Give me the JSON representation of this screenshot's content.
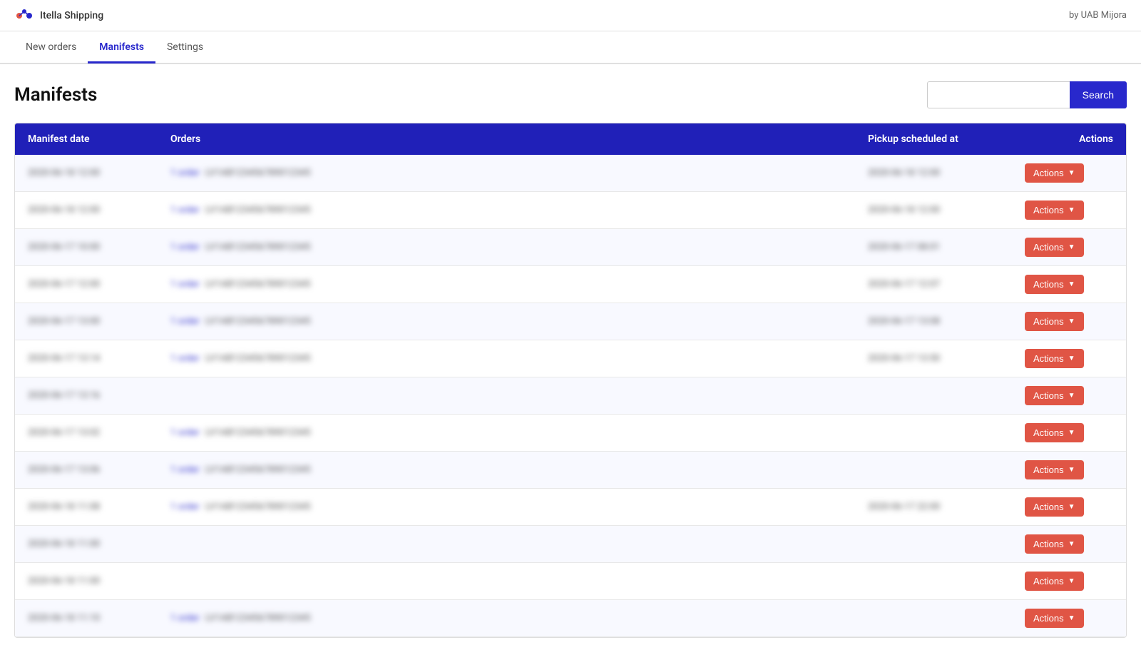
{
  "app": {
    "title": "Itella Shipping",
    "by_label": "by UAB Mijora"
  },
  "nav": {
    "items": [
      {
        "label": "New orders",
        "active": false
      },
      {
        "label": "Manifests",
        "active": true
      },
      {
        "label": "Settings",
        "active": false
      }
    ]
  },
  "page": {
    "title": "Manifests",
    "search_placeholder": "",
    "search_button": "Search"
  },
  "table": {
    "columns": [
      {
        "label": "Manifest date"
      },
      {
        "label": "Orders"
      },
      {
        "label": "Pickup scheduled at"
      },
      {
        "label": "Actions"
      }
    ],
    "rows": [
      {
        "date": "2020-06-18 12:00",
        "order_count": "1 order",
        "order_id": "LV1AB123456789012345",
        "pickup": "2020-06-18 12:00",
        "has_pickup": true
      },
      {
        "date": "2020-06-18 12:00",
        "order_count": "1 order",
        "order_id": "LV1AB123456789012345",
        "pickup": "2020-06-18 12:00",
        "has_pickup": true
      },
      {
        "date": "2020-06-17 10:00",
        "order_count": "1 order",
        "order_id": "LV1AB123456789012345",
        "pickup": "2020-06-17 08:01",
        "has_pickup": true
      },
      {
        "date": "2020-06-17 12:00",
        "order_count": "1 order",
        "order_id": "LV1AB123456789012345",
        "pickup": "2020-06-17 12:07",
        "has_pickup": true
      },
      {
        "date": "2020-06-17 13:00",
        "order_count": "1 order",
        "order_id": "LV1AB123456789012345",
        "pickup": "2020-06-17 13:08",
        "has_pickup": true
      },
      {
        "date": "2020-06-17 13:14",
        "order_count": "1 order",
        "order_id": "LV1AB123456789012345",
        "pickup": "2020-06-17 13:50",
        "has_pickup": true
      },
      {
        "date": "2020-06-17 13:16",
        "order_count": "",
        "order_id": "",
        "pickup": "",
        "has_pickup": false
      },
      {
        "date": "2020-06-17 13:02",
        "order_count": "1 order",
        "order_id": "LV1AB123456789012345",
        "pickup": "",
        "has_pickup": false
      },
      {
        "date": "2020-06-17 13:06",
        "order_count": "1 order",
        "order_id": "LV1AB123456789012345",
        "pickup": "",
        "has_pickup": false
      },
      {
        "date": "2020-06-18 11:08",
        "order_count": "1 order",
        "order_id": "LV1AB123456789012345",
        "pickup": "2020-06-17 22:00",
        "has_pickup": true
      },
      {
        "date": "2020-06-18 11:00",
        "order_count": "",
        "order_id": "",
        "pickup": "",
        "has_pickup": false
      },
      {
        "date": "2020-06-18 11:00",
        "order_count": "",
        "order_id": "",
        "pickup": "",
        "has_pickup": false
      },
      {
        "date": "2020-06-18 11:10",
        "order_count": "1 order",
        "order_id": "LV1AB123456789012345",
        "pickup": "",
        "has_pickup": false
      }
    ],
    "actions_label": "Actions"
  }
}
